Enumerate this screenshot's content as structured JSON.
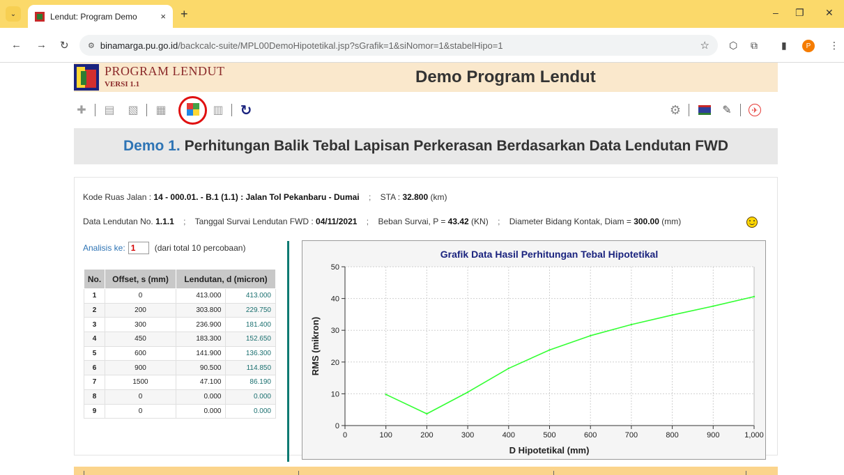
{
  "browser": {
    "tab_title": "Lendut: Program Demo",
    "tab_close": "×",
    "new_tab": "+",
    "url_host": "binamarga.pu.go.id",
    "url_path": "/backcalc-suite/MPL00DemoHipotetikal.jsp?sGrafik=1&siNomor=1&stabelHipo=1",
    "profile_initial": "P"
  },
  "app": {
    "logo_title": "PROGRAM LENDUT",
    "logo_version": "VERSI 1.1",
    "title": "Demo Program Lendut"
  },
  "banner": {
    "demo_no": "Demo 1.",
    "text": "Perhitungan Balik Tebal Lapisan Perkerasan Berdasarkan Data Lendutan FWD"
  },
  "info": {
    "kode_label": "Kode Ruas Jalan :",
    "kode_value": "14 - 000.01. - B.1 (1.1) : Jalan Tol Pekanbaru - Dumai",
    "sta_label": "STA :",
    "sta_value": "32.800",
    "sta_unit": "(km)",
    "data_label": "Data Lendutan No.",
    "data_value": "1.1.1",
    "tanggal_label": "Tanggal Survai Lendutan FWD :",
    "tanggal_value": "04/11/2021",
    "beban_label": "Beban Survai, P =",
    "beban_value": "43.42",
    "beban_unit": "(KN)",
    "diam_label": "Diameter Bidang Kontak, Diam =",
    "diam_value": "300.00",
    "diam_unit": "(mm)",
    "separator": ";"
  },
  "analisis": {
    "label": "Analisis ke:",
    "value": "1",
    "suffix": "(dari total 10 percobaan)"
  },
  "table": {
    "headers": [
      "No.",
      "Offset, s (mm)",
      "Lendutan, d (micron)"
    ],
    "rows": [
      {
        "no": "1",
        "offset": "0",
        "d": "413.000",
        "dh": "413.000"
      },
      {
        "no": "2",
        "offset": "200",
        "d": "303.800",
        "dh": "229.750"
      },
      {
        "no": "3",
        "offset": "300",
        "d": "236.900",
        "dh": "181.400"
      },
      {
        "no": "4",
        "offset": "450",
        "d": "183.300",
        "dh": "152.650"
      },
      {
        "no": "5",
        "offset": "600",
        "d": "141.900",
        "dh": "136.300"
      },
      {
        "no": "6",
        "offset": "900",
        "d": "90.500",
        "dh": "114.850"
      },
      {
        "no": "7",
        "offset": "1500",
        "d": "47.100",
        "dh": "86.190"
      },
      {
        "no": "8",
        "offset": "0",
        "d": "0.000",
        "dh": "0.000"
      },
      {
        "no": "9",
        "offset": "0",
        "d": "0.000",
        "dh": "0.000"
      }
    ]
  },
  "chart_data": {
    "type": "line",
    "title": "Grafik Data Hasil Perhitungan Tebal Hipotetikal",
    "xlabel": "D Hipotetikal (mm)",
    "ylabel": "RMS (mikron)",
    "xlim": [
      0,
      1000
    ],
    "ylim": [
      0,
      50
    ],
    "xticks": [
      "0",
      "100",
      "200",
      "300",
      "400",
      "500",
      "600",
      "700",
      "800",
      "900",
      "1,000"
    ],
    "yticks": [
      "0",
      "10",
      "20",
      "30",
      "40",
      "50"
    ],
    "grid": true,
    "line_color": "#33ff33",
    "x": [
      100,
      200,
      300,
      400,
      500,
      600,
      700,
      800,
      900,
      1000
    ],
    "y": [
      9.8,
      3.7,
      10.5,
      18,
      23.8,
      28.3,
      31.8,
      34.8,
      37.6,
      40.6
    ]
  },
  "colors": {
    "header_bg": "#fae8cc",
    "tab_bar": "#fbd96a",
    "accent_teal": "#0d7a72",
    "highlight_ring": "#e01010",
    "demo_blue": "#2e74b5"
  }
}
